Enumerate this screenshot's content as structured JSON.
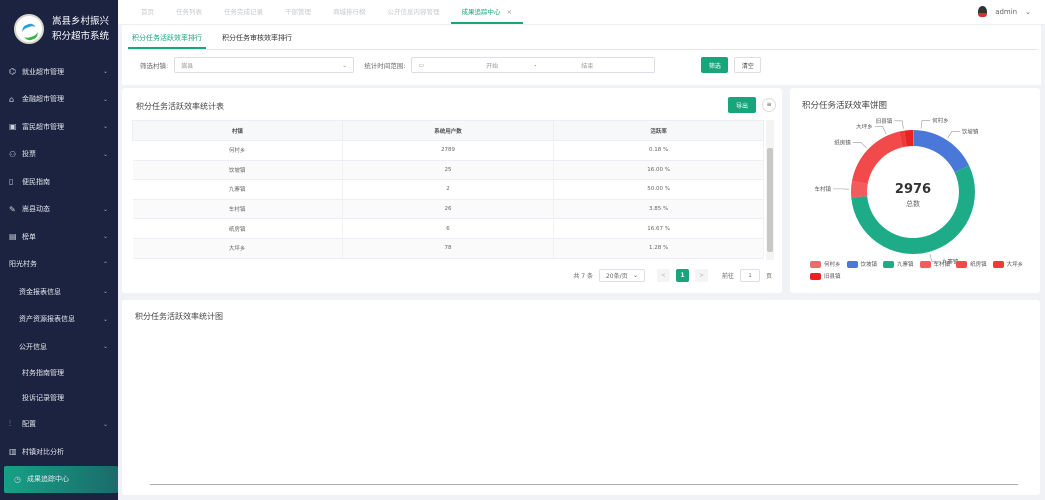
{
  "app": {
    "title_line1": "嵩县乡村振兴",
    "title_line2": "积分超市系统",
    "user": "admin"
  },
  "sidebar": {
    "items": [
      {
        "label": "就业超市管理",
        "icon": "sitemap-icon",
        "chev": "⌄"
      },
      {
        "label": "金融超市管理",
        "icon": "bag-icon",
        "chev": "⌄"
      },
      {
        "label": "富民超市管理",
        "icon": "monitor-icon",
        "chev": "⌄"
      },
      {
        "label": "投票",
        "icon": "users-icon",
        "chev": "⌄"
      },
      {
        "label": "便民指南",
        "icon": "document-icon",
        "chev": ""
      },
      {
        "label": "嵩县动态",
        "icon": "pen-icon",
        "chev": "⌄"
      },
      {
        "label": "榜单",
        "icon": "board-icon",
        "chev": "⌄"
      },
      {
        "label": "阳光村务",
        "icon": "",
        "chev": "⌃"
      },
      {
        "label": "资金报表信息",
        "icon": "",
        "chev": "⌄"
      },
      {
        "label": "资产资源报表信息",
        "icon": "",
        "chev": "⌄"
      },
      {
        "label": "公开信息",
        "icon": "",
        "chev": "⌄"
      },
      {
        "label": "村务指南管理",
        "icon": "",
        "chev": ""
      },
      {
        "label": "投诉记录管理",
        "icon": "",
        "chev": ""
      },
      {
        "label": "配置",
        "icon": "sliders-icon",
        "chev": "⌄"
      },
      {
        "label": "村镇对比分析",
        "icon": "chart-icon",
        "chev": ""
      },
      {
        "label": "成果追踪中心",
        "icon": "clock-icon",
        "chev": ""
      }
    ]
  },
  "tabs": [
    "首页",
    "任务列表",
    "任务完成记录",
    "干部管理",
    "商城排行榜",
    "公开信息内容管理",
    "成果追踪中心"
  ],
  "tab_close": "×",
  "subtabs": [
    "积分任务活跃效率排行",
    "积分任务审核效率排行"
  ],
  "filter": {
    "village_label": "筛选村镇:",
    "village_placeholder": "嵩县",
    "range_label": "统计时间范围:",
    "start_placeholder": "开始",
    "sep": "-",
    "end_placeholder": "结束",
    "search": "筛选",
    "clear": "清空"
  },
  "table_card": {
    "title": "积分任务活跃效率统计表",
    "export": "导出",
    "menu_icon": "≡",
    "columns": [
      "村镇",
      "系统用户数",
      "活跃率"
    ],
    "rows": [
      [
        "何村乡",
        "2789",
        "0.18 %"
      ],
      [
        "饮坡镇",
        "25",
        "16.00 %"
      ],
      [
        "九寨镇",
        "2",
        "50.00 %"
      ],
      [
        "车村镇",
        "26",
        "3.85 %"
      ],
      [
        "纸房镇",
        "6",
        "16.67 %"
      ],
      [
        "大坪乡",
        "78",
        "1.28 %"
      ]
    ],
    "pager": {
      "total": "共 7 条",
      "size": "20条/页",
      "prev": "<",
      "page": "1",
      "next": ">",
      "goto": "前往",
      "goto_placeholder": "1",
      "unit": "页"
    }
  },
  "chart_data": [
    {
      "type": "pie",
      "title": "积分任务活跃效率饼图",
      "center_value": "2976",
      "center_label": "总数",
      "categories": [
        "何村乡",
        "饮坡镇",
        "九寨镇",
        "车村镇",
        "纸房镇",
        "大坪乡",
        "旧县镇"
      ],
      "values": [
        0.18,
        16.0,
        50.0,
        3.85,
        16.67,
        1.28,
        2
      ],
      "colors": [
        "#ee6b6b",
        "#4a78d8",
        "#1eac88",
        "#f25c5c",
        "#f24a4a",
        "#f03a3a",
        "#e62424"
      ],
      "legend": "bottom"
    },
    {
      "type": "bar",
      "title": "积分任务活跃效率统计图",
      "categories": [],
      "values": []
    }
  ]
}
